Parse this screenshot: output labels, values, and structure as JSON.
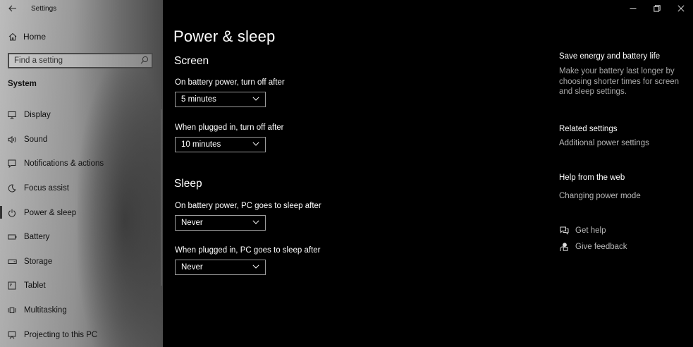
{
  "app": {
    "title": "Settings"
  },
  "sidebar": {
    "home_label": "Home",
    "search": {
      "placeholder": "Find a setting"
    },
    "section_label": "System",
    "items": [
      {
        "label": "Display",
        "icon": "display-icon"
      },
      {
        "label": "Sound",
        "icon": "sound-icon"
      },
      {
        "label": "Notifications & actions",
        "icon": "notifications-icon"
      },
      {
        "label": "Focus assist",
        "icon": "focus-assist-icon"
      },
      {
        "label": "Power & sleep",
        "icon": "power-icon",
        "active": true
      },
      {
        "label": "Battery",
        "icon": "battery-icon"
      },
      {
        "label": "Storage",
        "icon": "storage-icon"
      },
      {
        "label": "Tablet",
        "icon": "tablet-icon"
      },
      {
        "label": "Multitasking",
        "icon": "multitasking-icon"
      },
      {
        "label": "Projecting to this PC",
        "icon": "projecting-icon"
      }
    ]
  },
  "main": {
    "page_title": "Power & sleep",
    "screen": {
      "heading": "Screen",
      "battery_label": "On battery power, turn off after",
      "battery_value": "5 minutes",
      "plugged_label": "When plugged in, turn off after",
      "plugged_value": "10 minutes"
    },
    "sleep": {
      "heading": "Sleep",
      "battery_label": "On battery power, PC goes to sleep after",
      "battery_value": "Never",
      "plugged_label": "When plugged in, PC goes to sleep after",
      "plugged_value": "Never"
    }
  },
  "right_panel": {
    "save_energy": {
      "heading": "Save energy and battery life",
      "body": "Make your battery last longer by choosing shorter times for screen and sleep settings."
    },
    "related": {
      "heading": "Related settings",
      "link": "Additional power settings"
    },
    "help_web": {
      "heading": "Help from the web",
      "link": "Changing power mode"
    },
    "get_help": "Get help",
    "give_feedback": "Give feedback"
  },
  "colors": {
    "background": "#000000",
    "dropdown_border": "#9a9a9a",
    "secondary_text": "#a8a8a8"
  }
}
